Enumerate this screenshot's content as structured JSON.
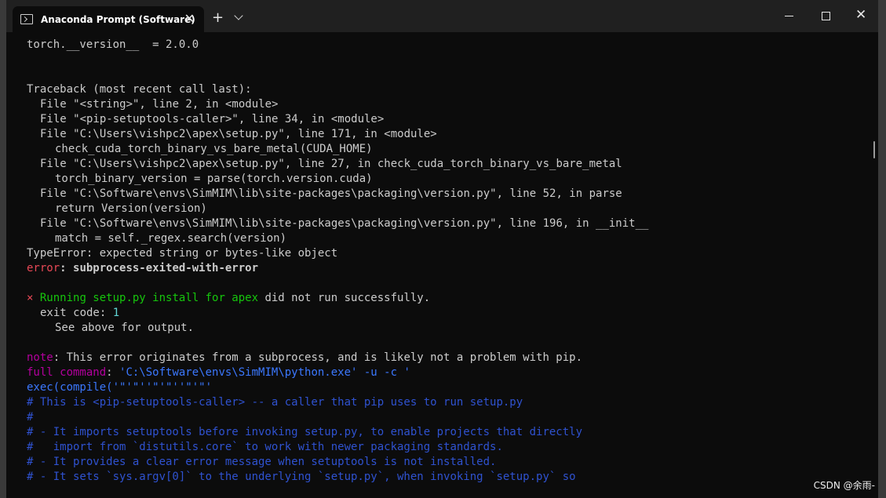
{
  "window": {
    "tab_title": "Anaconda Prompt (Software)",
    "tab_close": "✕",
    "new_tab": "+",
    "close_glyph": "✕"
  },
  "console": {
    "version_line": "torch.__version__  = 2.0.0",
    "tb_header": "Traceback (most recent call last):",
    "tb1": "File \"<string>\", line 2, in <module>",
    "tb2": "File \"<pip-setuptools-caller>\", line 34, in <module>",
    "tb3": "File \"C:\\Users\\vishpc2\\apex\\setup.py\", line 171, in <module>",
    "tb3b": "check_cuda_torch_binary_vs_bare_metal(CUDA_HOME)",
    "tb4": "File \"C:\\Users\\vishpc2\\apex\\setup.py\", line 27, in check_cuda_torch_binary_vs_bare_metal",
    "tb4b": "torch_binary_version = parse(torch.version.cuda)",
    "tb5": "File \"C:\\Software\\envs\\SimMIM\\lib\\site-packages\\packaging\\version.py\", line 52, in parse",
    "tb5b": "return Version(version)",
    "tb6": "File \"C:\\Software\\envs\\SimMIM\\lib\\site-packages\\packaging\\version.py\", line 196, in __init__",
    "tb6b": "match = self._regex.search(version)",
    "type_error": "TypeError: expected string or bytes-like object",
    "err_label": "error",
    "err_msg": ": subprocess-exited-with-error",
    "x_mark": "×",
    "running_text": " Running setup.py install for apex",
    "did_not": " did not run successfully.",
    "exit_prefix": "exit code: ",
    "exit_code": "1",
    "see_above": "See above for output.",
    "note_label": "note",
    "note_msg": ": This error originates from a subprocess, and is likely not a problem with pip.",
    "full_label": "full command",
    "full_colon": ": ",
    "full_value": "'C:\\Software\\envs\\SimMIM\\python.exe' -u -c '",
    "exec_line": "exec(compile('\"'\"''\"'\"''\"'\"'",
    "c1": "# This is <pip-setuptools-caller> -- a caller that pip uses to run setup.py",
    "c2": "#",
    "c3": "# - It imports setuptools before invoking setup.py, to enable projects that directly",
    "c4": "#   import from `distutils.core` to work with newer packaging standards.",
    "c5": "# - It provides a clear error message when setuptools is not installed.",
    "c6": "# - It sets `sys.argv[0]` to the underlying `setup.py`, when invoking `setup.py` so"
  },
  "watermark": "CSDN @余雨-"
}
